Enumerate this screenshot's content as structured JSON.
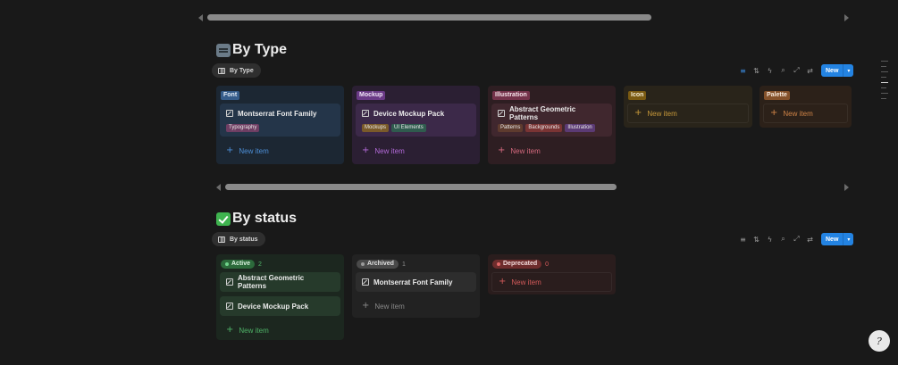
{
  "sections": {
    "by_type": {
      "title": "By Type",
      "emoji": "keyboard-emoji",
      "view_tab": "By Type",
      "toolbar": {
        "new_label": "New"
      },
      "columns": [
        {
          "label": "Font",
          "tag_bg": "#365c8a",
          "tag_fg": "#e3ecf7",
          "col_bg": "#1c2733",
          "card_bg": "#243549",
          "new_color": "#4d8fd8",
          "cards": [
            {
              "title": "Montserrat Font Family",
              "tags": [
                {
                  "label": "Typography",
                  "bg": "#6e3e63"
                }
              ]
            }
          ]
        },
        {
          "label": "Mockup",
          "tag_bg": "#6a3a86",
          "tag_fg": "#f0e4f7",
          "col_bg": "#2b1f33",
          "card_bg": "#3c2949",
          "new_color": "#b36ad9",
          "cards": [
            {
              "title": "Device Mockup Pack",
              "tags": [
                {
                  "label": "Mockups",
                  "bg": "#7a5a2a"
                },
                {
                  "label": "UI Elements",
                  "bg": "#2f5b4e"
                }
              ]
            }
          ]
        },
        {
          "label": "Illustration",
          "tag_bg": "#74324a",
          "tag_fg": "#f7e4eb",
          "col_bg": "#2e1e22",
          "card_bg": "#40272e",
          "new_color": "#d66a7f",
          "cards": [
            {
              "title": "Abstract Geometric Patterns",
              "tags": [
                {
                  "label": "Patterns",
                  "bg": "#5e3b2e"
                },
                {
                  "label": "Backgrounds",
                  "bg": "#7a3434"
                },
                {
                  "label": "Illustration",
                  "bg": "#5b3a74"
                }
              ]
            }
          ]
        },
        {
          "label": "Icon",
          "tag_bg": "#7a5a12",
          "tag_fg": "#f7efd8",
          "col_bg": "#29241a",
          "card_bg": "#29241a",
          "new_color": "#c99a3a",
          "cards": []
        },
        {
          "label": "Palette",
          "tag_bg": "#84512a",
          "tag_fg": "#f7e9dc",
          "col_bg": "#2c2119",
          "card_bg": "#2c2119",
          "new_color": "#d08447",
          "cards": []
        }
      ]
    },
    "by_status": {
      "title": "By status",
      "emoji": "check-mark-emoji",
      "view_tab": "By status",
      "toolbar": {
        "new_label": "New"
      },
      "columns": [
        {
          "label": "Active",
          "count": "2",
          "pill_bg": "#2c6a3b",
          "pill_fg": "#d9f2df",
          "dot": "#6fd38a",
          "count_color": "#4fb468",
          "col_bg": "#1c271f",
          "card_bg": "#263a2b",
          "new_color": "#4fb468",
          "cards": [
            {
              "title": "Abstract Geometric Patterns",
              "tags": []
            },
            {
              "title": "Device Mockup Pack",
              "tags": []
            }
          ]
        },
        {
          "label": "Archived",
          "count": "1",
          "pill_bg": "#4a4a4a",
          "pill_fg": "#e0e0e0",
          "dot": "#9a9a9a",
          "count_color": "#8a8a8a",
          "col_bg": "#222222",
          "card_bg": "#2d2d2d",
          "new_color": "#8a8a8a",
          "cards": [
            {
              "title": "Montserrat Font Family",
              "tags": []
            }
          ]
        },
        {
          "label": "Deprecated",
          "count": "0",
          "pill_bg": "#6e2d2d",
          "pill_fg": "#f4dcdc",
          "dot": "#e26a6a",
          "count_color": "#d45a5a",
          "col_bg": "#2a1d1d",
          "card_bg": "#2a1d1d",
          "new_color": "#d45a5a",
          "cards": []
        }
      ]
    }
  },
  "new_item_label": "New item",
  "help_button": "?"
}
